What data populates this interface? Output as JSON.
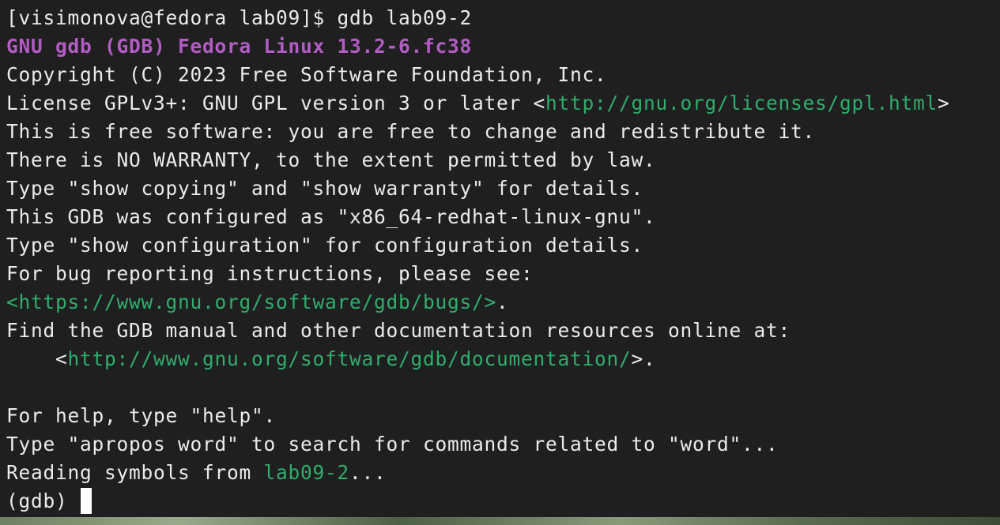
{
  "terminal": {
    "shell_prompt": "[visimonova@fedora lab09]$ ",
    "shell_command": "gdb lab09-2",
    "banner": "GNU gdb (GDB) Fedora Linux 13.2-6.fc38",
    "copyright": "Copyright (C) 2023 Free Software Foundation, Inc.",
    "license_prefix": "License GPLv3+: GNU GPL version 3 or later <",
    "license_url": "http://gnu.org/licenses/gpl.html",
    "license_suffix": ">",
    "free_software": "This is free software: you are free to change and redistribute it.",
    "no_warranty": "There is NO WARRANTY, to the extent permitted by law.",
    "show_copying": "Type \"show copying\" and \"show warranty\" for details.",
    "configured_as": "This GDB was configured as \"x86_64-redhat-linux-gnu\".",
    "show_configuration": "Type \"show configuration\" for configuration details.",
    "bug_reporting": "For bug reporting instructions, please see:",
    "bugs_url": "<https://www.gnu.org/software/gdb/bugs/>",
    "bugs_suffix": ".",
    "find_manual": "Find the GDB manual and other documentation resources online at:",
    "docs_prefix": "    <",
    "docs_url": "http://www.gnu.org/software/gdb/documentation/",
    "docs_suffix": ">.",
    "help_hint": "For help, type \"help\".",
    "apropos_hint": "Type \"apropos word\" to search for commands related to \"word\"...",
    "reading_prefix": "Reading symbols from ",
    "reading_file": "lab09-2",
    "reading_suffix": "...",
    "gdb_prompt": "(gdb) "
  },
  "colors": {
    "background": "#1f1f1f",
    "foreground": "#ebebeb",
    "banner": "#b35cc5",
    "link": "#2fae6c"
  }
}
